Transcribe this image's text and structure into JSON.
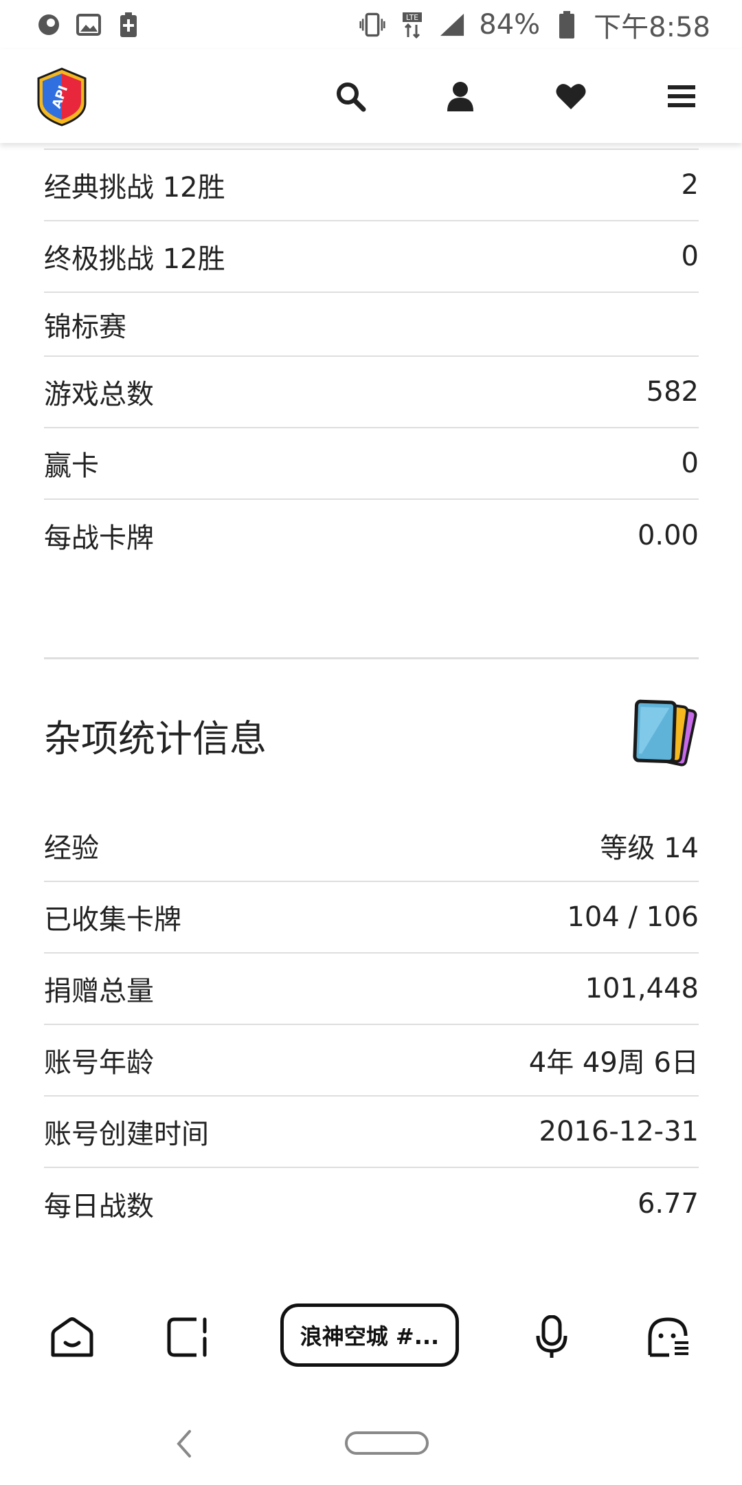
{
  "status_bar": {
    "left_icons": [
      "notification-circle-icon",
      "image-icon",
      "battery-saver-icon"
    ],
    "right_icons": [
      "vibrate-icon",
      "lte-icon",
      "signal-icon",
      "battery-icon"
    ],
    "battery": "84%",
    "time": "下午8:58"
  },
  "header": {
    "logo_text": "API",
    "icons": [
      "search-icon",
      "user-icon",
      "heart-icon",
      "menu-icon"
    ]
  },
  "stats_top": {
    "rows": [
      {
        "label": "经典挑战 12胜",
        "value": "2"
      },
      {
        "label": "终极挑战 12胜",
        "value": "0"
      },
      {
        "label": "锦标赛",
        "value": ""
      },
      {
        "label": "游戏总数",
        "value": "582"
      },
      {
        "label": "赢卡",
        "value": "0"
      },
      {
        "label": "每战卡牌",
        "value": "0.00"
      }
    ]
  },
  "misc_section": {
    "title": "杂项统计信息",
    "icon": "cards-icon",
    "rows": [
      {
        "label": "经验",
        "value": "等级 14"
      },
      {
        "label": "已收集卡牌",
        "value": "104 / 106"
      },
      {
        "label": "捐赠总量",
        "value": "101,448"
      },
      {
        "label": "账号年龄",
        "value": "4年 49周 6日"
      },
      {
        "label": "账号创建时间",
        "value": "2016-12-31"
      },
      {
        "label": "每日战数",
        "value": "6.77"
      }
    ]
  },
  "bottom_toolbar": {
    "url_label": "浪神空城 #...",
    "icons": [
      "home-icon",
      "tabs-icon",
      "microphone-icon",
      "assistant-icon"
    ]
  },
  "colors": {
    "text": "#222222",
    "divider": "#dedede",
    "logo_blue": "#2f6fe0",
    "logo_red": "#e8273c",
    "logo_gold": "#f5b81f"
  }
}
